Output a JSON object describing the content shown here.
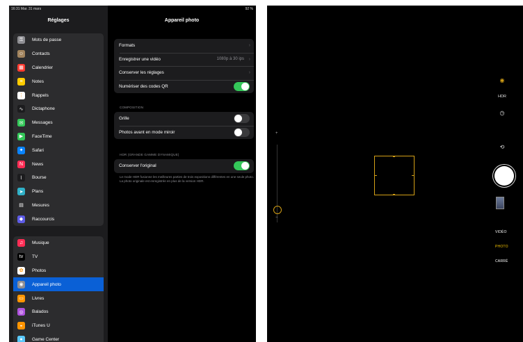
{
  "status": {
    "time": "16:31 Mar. 31 mars",
    "battery": "92 %"
  },
  "sidebar": {
    "title": "Réglages",
    "group1": [
      {
        "label": "Mots de passe",
        "icon": "key-icon",
        "color": "#8e8e93",
        "glyph": "⚿"
      },
      {
        "label": "Contacts",
        "icon": "contacts-icon",
        "color": "#a2845e",
        "glyph": "☺"
      },
      {
        "label": "Calendrier",
        "icon": "calendar-icon",
        "color": "#ff3b30",
        "glyph": "▦"
      },
      {
        "label": "Notes",
        "icon": "notes-icon",
        "color": "#ffcc00",
        "glyph": "≡"
      },
      {
        "label": "Rappels",
        "icon": "reminders-icon",
        "color": "#ffffff",
        "glyph": "⋮"
      },
      {
        "label": "Dictaphone",
        "icon": "dictaphone-icon",
        "color": "#1c1c1e",
        "glyph": "∿"
      },
      {
        "label": "Messages",
        "icon": "messages-icon",
        "color": "#34c759",
        "glyph": "✉"
      },
      {
        "label": "FaceTime",
        "icon": "facetime-icon",
        "color": "#34c759",
        "glyph": "▶"
      },
      {
        "label": "Safari",
        "icon": "safari-icon",
        "color": "#0a84ff",
        "glyph": "✦"
      },
      {
        "label": "News",
        "icon": "news-icon",
        "color": "#ff2d55",
        "glyph": "N"
      },
      {
        "label": "Bourse",
        "icon": "stocks-icon",
        "color": "#1c1c1e",
        "glyph": "⌇"
      },
      {
        "label": "Plans",
        "icon": "maps-icon",
        "color": "#30b0c7",
        "glyph": "➤"
      },
      {
        "label": "Mesures",
        "icon": "measure-icon",
        "color": "#2c2c2e",
        "glyph": "▤"
      },
      {
        "label": "Raccourcis",
        "icon": "shortcuts-icon",
        "color": "#5e5ce6",
        "glyph": "◆"
      }
    ],
    "group2": [
      {
        "label": "Musique",
        "icon": "music-icon",
        "color": "#ff2d55",
        "glyph": "♫"
      },
      {
        "label": "TV",
        "icon": "tv-icon",
        "color": "#000000",
        "glyph": "tv"
      },
      {
        "label": "Photos",
        "icon": "photos-icon",
        "color": "#ffffff",
        "glyph": "✿"
      },
      {
        "label": "Appareil photo",
        "icon": "camera-icon",
        "color": "#8e8e93",
        "glyph": "◉",
        "selected": true
      },
      {
        "label": "Livres",
        "icon": "books-icon",
        "color": "#ff9500",
        "glyph": "▭"
      },
      {
        "label": "Balados",
        "icon": "podcasts-icon",
        "color": "#af52de",
        "glyph": "◎"
      },
      {
        "label": "iTunes U",
        "icon": "itunes-u-icon",
        "color": "#ff9500",
        "glyph": "◒"
      },
      {
        "label": "Game Center",
        "icon": "game-center-icon",
        "color": "#5ac8fa",
        "glyph": "●"
      }
    ]
  },
  "detail": {
    "title": "Appareil photo",
    "formats": "Formats",
    "record_video": "Enregistrer une vidéo",
    "record_video_value": "1080p à 30 ips",
    "keep_settings": "Conserver les réglages",
    "scan_qr": "Numériser des codes QR",
    "section_composition": "COMPOSITION",
    "grid": "Grille",
    "mirror": "Photos avant en mode miroir",
    "section_hdr": "HDR (GRANDE GAMME DYNAMIQUE)",
    "keep_original": "Conserver l'original",
    "hdr_note": "Le mode HDR fusionne les meilleures parties de trois expositions différentes en une seule photo. La photo originale est enregistrée en plus de la version HDR."
  },
  "camera": {
    "zoom_plus": "+",
    "zoom_minus": "−",
    "hdr_label": "HDR",
    "modes": [
      "VIDÉO",
      "PHOTO",
      "CARRÉ"
    ],
    "active_mode": "PHOTO"
  }
}
